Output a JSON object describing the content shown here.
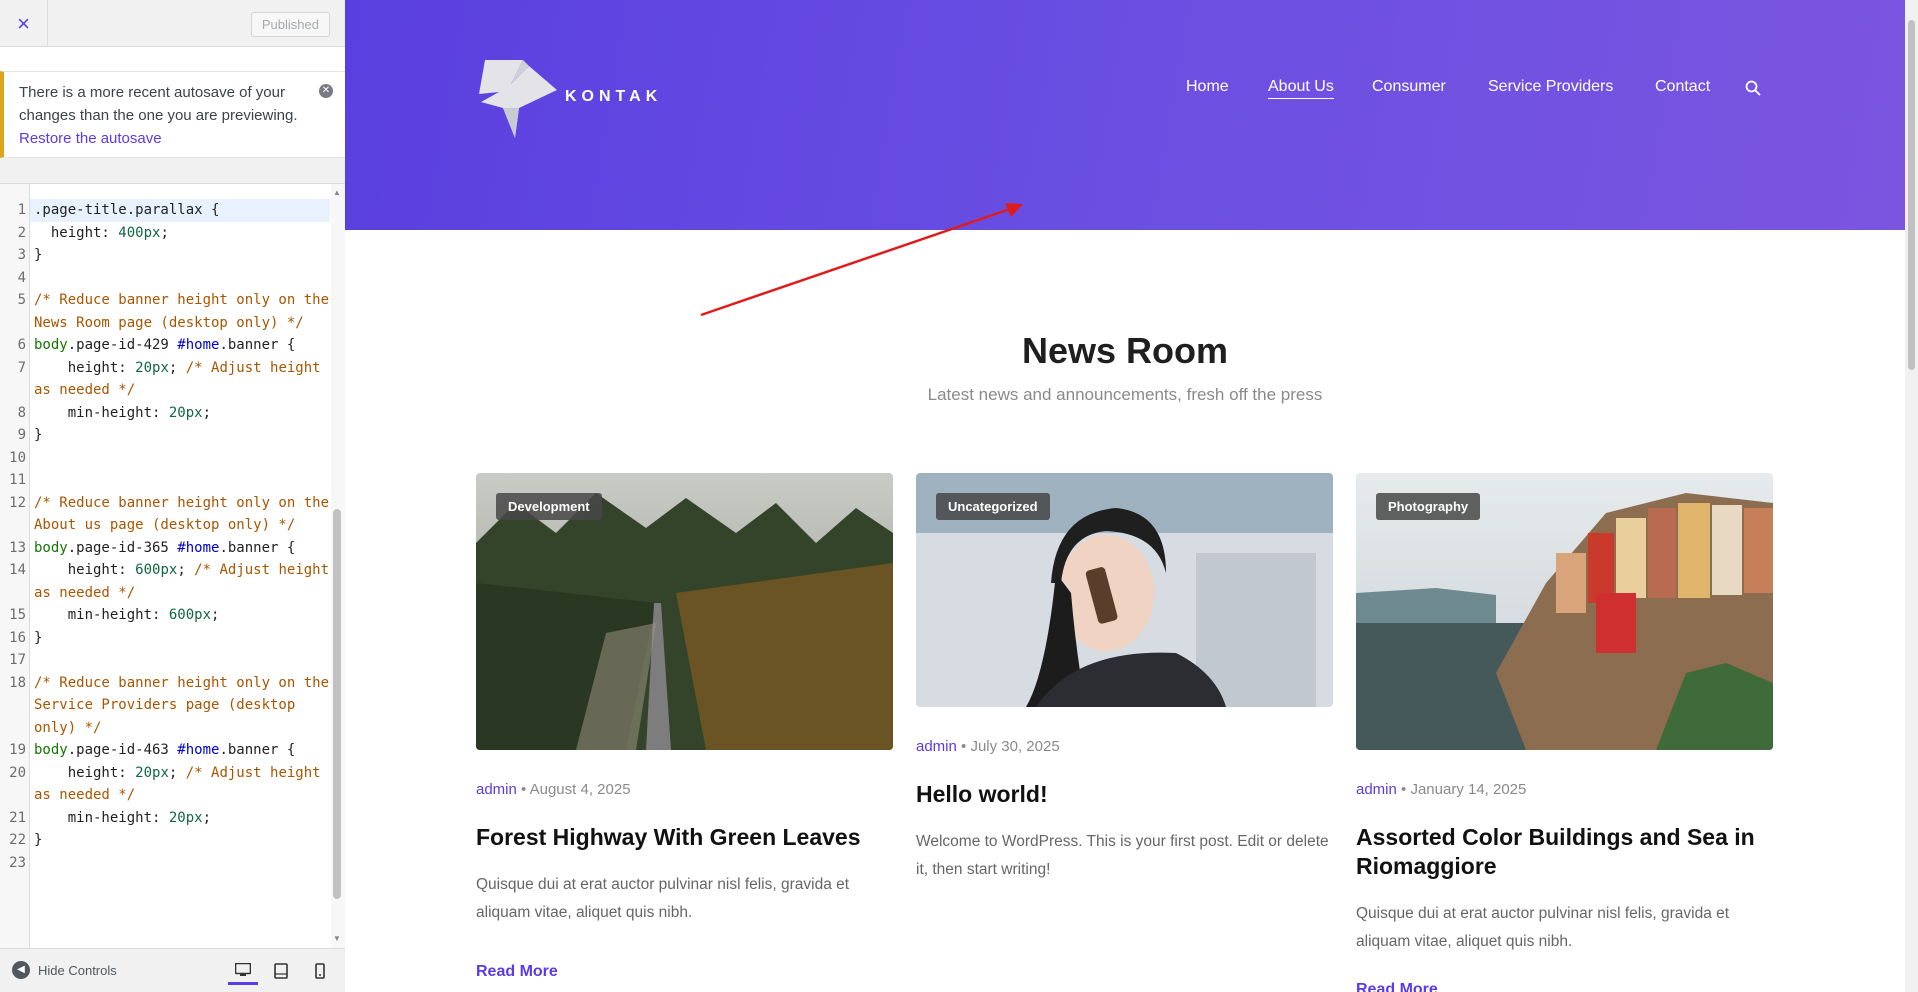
{
  "customizer": {
    "close_icon": "×",
    "publish_label": "Published",
    "notice": {
      "text": "There is a more recent autosave of your changes than the one you are previewing.",
      "link": "Restore the autosave"
    },
    "code": [
      {
        "n": "1",
        "t": ".page-title.parallax {"
      },
      {
        "n": "2",
        "t": "  height: 400px;"
      },
      {
        "n": "3",
        "t": "}"
      },
      {
        "n": "4",
        "t": ""
      },
      {
        "n": "5",
        "t": "/* Reduce banner height only on the News Room page (desktop only) */"
      },
      {
        "n": "6",
        "t": "body.page-id-429 #home.banner {"
      },
      {
        "n": "7",
        "t": "    height: 20px; /* Adjust height as needed */"
      },
      {
        "n": "8",
        "t": "    min-height: 20px;"
      },
      {
        "n": "9",
        "t": "}"
      },
      {
        "n": "10",
        "t": ""
      },
      {
        "n": "11",
        "t": ""
      },
      {
        "n": "12",
        "t": "/* Reduce banner height only on the About us page (desktop only) */"
      },
      {
        "n": "13",
        "t": "body.page-id-365 #home.banner {"
      },
      {
        "n": "14",
        "t": "    height: 600px; /* Adjust height as needed */"
      },
      {
        "n": "15",
        "t": "    min-height: 600px;"
      },
      {
        "n": "16",
        "t": "}"
      },
      {
        "n": "17",
        "t": ""
      },
      {
        "n": "18",
        "t": "/* Reduce banner height only on the Service Providers page (desktop only) */"
      },
      {
        "n": "19",
        "t": "body.page-id-463 #home.banner {"
      },
      {
        "n": "20",
        "t": "    height: 20px; /* Adjust height as needed */"
      },
      {
        "n": "21",
        "t": "    min-height: 20px;"
      },
      {
        "n": "22",
        "t": "}"
      },
      {
        "n": "23",
        "t": ""
      }
    ],
    "footer": {
      "hide_controls": "Hide Controls",
      "devices": [
        "desktop-icon",
        "tablet-icon",
        "mobile-icon"
      ]
    }
  },
  "site": {
    "logo_text": "KONTAK",
    "nav": [
      "Home",
      "About Us",
      "Consumer",
      "Service Providers",
      "Contact"
    ],
    "current_nav": "About Us",
    "section_title": "News Room",
    "section_subtitle": "Latest news and announcements, fresh off the press",
    "posts": [
      {
        "category": "Development",
        "author": "admin",
        "date": "• August 4, 2025",
        "title": "Forest Highway With Green Leaves",
        "excerpt": "Quisque dui at erat auctor pulvinar nisl felis, gravida et aliquam vitae, aliquet quis nibh.",
        "read_more": "Read More"
      },
      {
        "category": "Uncategorized",
        "author": "admin",
        "date": "• July 30, 2025",
        "title": "Hello world!",
        "excerpt": "Welcome to WordPress. This is your first post. Edit or delete it, then start writing!"
      },
      {
        "category": "Photography",
        "author": "admin",
        "date": "• January 14, 2025",
        "title": "Assorted Color Buildings and Sea in Riomaggiore",
        "excerpt": "Quisque dui at erat auctor pulvinar nisl felis, gravida et aliquam vitae, aliquet quis nibh.",
        "read_more": "Read More"
      }
    ]
  },
  "colors": {
    "accent": "#5b3be6",
    "hero_start": "#5a3fe0",
    "hero_end": "#7b55e0",
    "annotation_arrow": "#e01b1b",
    "notice_border": "#dba617"
  }
}
